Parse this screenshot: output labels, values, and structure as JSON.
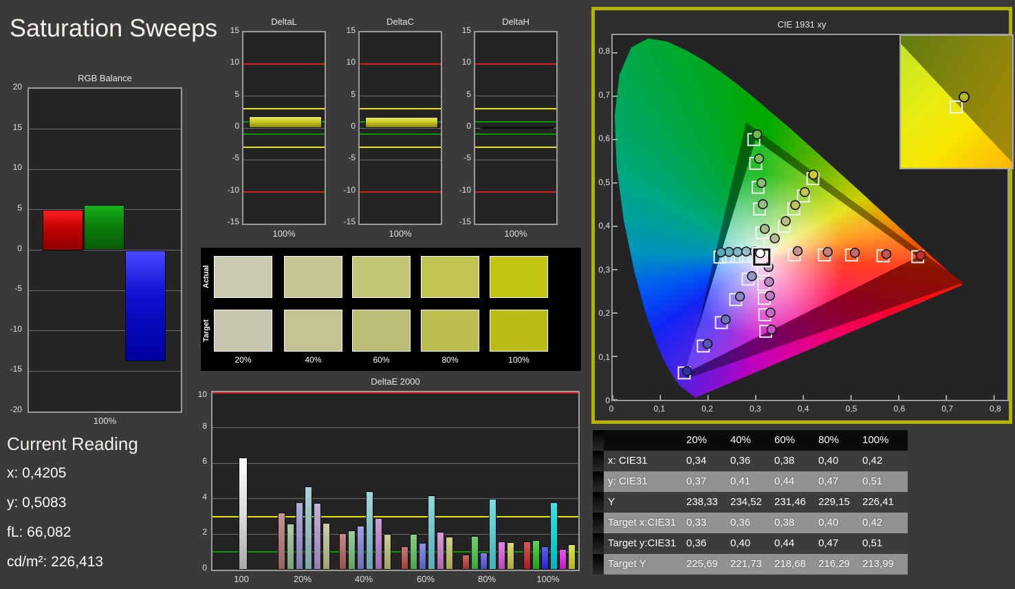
{
  "title": "Saturation Sweeps",
  "current_reading": {
    "heading": "Current Reading",
    "lines": [
      "x: 0,4205",
      "y: 0,5083",
      "fL: 66,082",
      "cd/m²: 226,413"
    ]
  },
  "chart_data": [
    {
      "id": "rgb_balance",
      "type": "bar",
      "title": "RGB Balance",
      "xlabel": "100%",
      "ylim": [
        -20,
        20
      ],
      "yticks": [
        -20,
        -15,
        -10,
        -5,
        0,
        5,
        10,
        15,
        20
      ],
      "series": [
        {
          "name": "red",
          "value": 5.0
        },
        {
          "name": "green",
          "value": 5.6
        },
        {
          "name": "blue",
          "value": -13.8
        }
      ]
    },
    {
      "id": "delta_charts",
      "type": "bar",
      "titles": [
        "DeltaL",
        "DeltaC",
        "DeltaH"
      ],
      "values": [
        1.8,
        1.7,
        0.05
      ],
      "xlabel": "100%",
      "ylim": [
        -15,
        15
      ],
      "yticks": [
        -15,
        -10,
        -5,
        0,
        5,
        10,
        15
      ],
      "ref_lines": [
        {
          "value": 10,
          "color": "#d42222"
        },
        {
          "value": -10,
          "color": "#d42222"
        },
        {
          "value": 3,
          "color": "#e6e600"
        },
        {
          "value": -3,
          "color": "#e6e600"
        },
        {
          "value": 1,
          "color": "#0c9a0c"
        },
        {
          "value": -1,
          "color": "#0c9a0c"
        }
      ]
    },
    {
      "id": "deltae_2000",
      "type": "bar",
      "title": "DeltaE 2000",
      "ylim": [
        0,
        10
      ],
      "yticks": [
        0,
        2,
        4,
        6,
        8,
        10
      ],
      "ref_lines": [
        {
          "value": 10,
          "color": "#d42222"
        },
        {
          "value": 3,
          "color": "#e6e600"
        },
        {
          "value": 1,
          "color": "#0c9a0c"
        }
      ],
      "groups": [
        {
          "label": "100",
          "values": [
            6.3
          ],
          "colors": [
            "white"
          ]
        },
        {
          "label": "20%",
          "values": [
            3.2,
            2.6,
            3.8,
            4.7,
            3.75,
            2.65
          ],
          "colors": [
            "#b57272",
            "#8fbd8f",
            "#9396cf",
            "#92c3cb",
            "#b295cd",
            "#bcbc8d"
          ]
        },
        {
          "label": "40%",
          "values": [
            2.05,
            2.2,
            2.5,
            4.4,
            2.9,
            2.0
          ],
          "colors": [
            "#b35f5f",
            "#76c076",
            "#7f82d6",
            "#7fc7d2",
            "#b57fd0",
            "#bcbc76"
          ]
        },
        {
          "label": "60%",
          "values": [
            1.3,
            2.0,
            1.5,
            4.2,
            2.15,
            1.85
          ],
          "colors": [
            "#b54c4c",
            "#5cc25c",
            "#6b6edd",
            "#66ccd6",
            "#cc7ccc",
            "#c3c35f"
          ]
        },
        {
          "label": "80%",
          "values": [
            0.85,
            1.9,
            0.95,
            4.0,
            1.6,
            1.55
          ],
          "colors": [
            "#bb3a3a",
            "#3fc43f",
            "#5456e4",
            "#4cd2da",
            "#dd55dd",
            "#caca47"
          ]
        },
        {
          "label": "100%",
          "values": [
            1.6,
            1.65,
            1.3,
            3.8,
            1.15,
            1.45
          ],
          "colors": [
            "#cc2222",
            "#22c022",
            "#2a2aee",
            "#00d8d8",
            "#dd22dd",
            "#d4d422"
          ]
        }
      ]
    },
    {
      "id": "cie_1931",
      "type": "scatter",
      "title": "CIE 1931 xy",
      "xticks": [
        "0",
        "0,1",
        "0,2",
        "0,3",
        "0,4",
        "0,5",
        "0,6",
        "0,7",
        "0,8"
      ],
      "yticks": [
        "0",
        "0,1",
        "0,2",
        "0,3",
        "0,4",
        "0,5",
        "0,6",
        "0,7",
        "0,8"
      ],
      "white_point": {
        "target": [
          0.3127,
          0.329
        ],
        "actual": [
          0.3095,
          0.338
        ]
      },
      "sweeps": [
        {
          "name": "red",
          "targets": [
            [
              0.381,
              0.334
            ],
            [
              0.444,
              0.334
            ],
            [
              0.501,
              0.334
            ],
            [
              0.567,
              0.332
            ],
            [
              0.64,
              0.33
            ]
          ],
          "actuals": [
            [
              0.388,
              0.343
            ],
            [
              0.451,
              0.341
            ],
            [
              0.508,
              0.339
            ],
            [
              0.574,
              0.336
            ],
            [
              0.646,
              0.333
            ]
          ],
          "actual_colors": [
            "#c49090",
            "#c47f7f",
            "#c46a6a",
            "#c45252",
            "#c63030"
          ]
        },
        {
          "name": "green",
          "targets": [
            [
              0.313,
              0.385
            ],
            [
              0.308,
              0.44
            ],
            [
              0.305,
              0.49
            ],
            [
              0.3,
              0.545
            ],
            [
              0.296,
              0.6
            ]
          ],
          "actuals": [
            [
              0.319,
              0.394
            ],
            [
              0.315,
              0.451
            ],
            [
              0.312,
              0.5
            ],
            [
              0.307,
              0.556
            ],
            [
              0.303,
              0.612
            ]
          ],
          "actual_colors": [
            "#a8bc8e",
            "#9cbc82",
            "#8cbc74",
            "#7cbc62",
            "#6cbc50"
          ]
        },
        {
          "name": "blue",
          "targets": [
            [
              0.284,
              0.278
            ],
            [
              0.258,
              0.231
            ],
            [
              0.228,
              0.178
            ],
            [
              0.19,
              0.124
            ],
            [
              0.15,
              0.062
            ]
          ],
          "actuals": [
            [
              0.292,
              0.285
            ],
            [
              0.267,
              0.238
            ],
            [
              0.237,
              0.185
            ],
            [
              0.199,
              0.129
            ],
            [
              0.156,
              0.066
            ]
          ],
          "actual_colors": [
            "#9898c6",
            "#8888c6",
            "#7070c2",
            "#5858bc",
            "#3030a8"
          ]
        },
        {
          "name": "cyan",
          "targets": [
            [
              0.296,
              0.331
            ],
            [
              0.279,
              0.331
            ],
            [
              0.261,
              0.33
            ],
            [
              0.243,
              0.33
            ],
            [
              0.225,
              0.329
            ]
          ],
          "actuals": [
            [
              0.297,
              0.342
            ],
            [
              0.28,
              0.342
            ],
            [
              0.262,
              0.341
            ],
            [
              0.244,
              0.341
            ],
            [
              0.227,
              0.34
            ]
          ],
          "actual_colors": [
            "#a2c2ca",
            "#92beca",
            "#7eb8c6",
            "#68b2c2",
            "#50acc0"
          ]
        },
        {
          "name": "magenta",
          "targets": [
            [
              0.316,
              0.3
            ],
            [
              0.317,
              0.266
            ],
            [
              0.318,
              0.234
            ],
            [
              0.319,
              0.196
            ],
            [
              0.321,
              0.158
            ]
          ],
          "actuals": [
            [
              0.327,
              0.306
            ],
            [
              0.328,
              0.272
            ],
            [
              0.33,
              0.24
            ],
            [
              0.331,
              0.201
            ],
            [
              0.333,
              0.162
            ]
          ],
          "actual_colors": [
            "#b894c6",
            "#bc88c6",
            "#c27cc6",
            "#c66cc6",
            "#ca50ca"
          ]
        },
        {
          "name": "yellow",
          "targets": [
            [
              0.33,
              0.36
            ],
            [
              0.36,
              0.4
            ],
            [
              0.38,
              0.44
            ],
            [
              0.4,
              0.47
            ],
            [
              0.42,
              0.51
            ]
          ],
          "actuals": [
            [
              0.34,
              0.372
            ],
            [
              0.363,
              0.412
            ],
            [
              0.383,
              0.449
            ],
            [
              0.403,
              0.479
            ],
            [
              0.421,
              0.519
            ]
          ],
          "actual_colors": [
            "#bcbc94",
            "#bcbc7e",
            "#c0c066",
            "#c4c44e",
            "#c8c832"
          ]
        }
      ]
    }
  ],
  "swatches": {
    "row_labels": [
      "Actual",
      "Target"
    ],
    "col_labels": [
      "20%",
      "40%",
      "60%",
      "80%",
      "100%"
    ],
    "actual_colors": [
      "#c9c9b0",
      "#c6c694",
      "#c3c577",
      "#c3c553",
      "#c3c513"
    ],
    "target_colors": [
      "#c6c6ae",
      "#c2c292",
      "#bcbd75",
      "#babc50",
      "#b9bc15"
    ]
  },
  "table": {
    "col_headers": [
      "20%",
      "40%",
      "60%",
      "80%",
      "100%"
    ],
    "rows": [
      {
        "label": "x: CIE31",
        "values": [
          "0,34",
          "0,36",
          "0,38",
          "0,40",
          "0,42"
        ]
      },
      {
        "label": "y: CIE31",
        "values": [
          "0,37",
          "0,41",
          "0,44",
          "0,47",
          "0,51"
        ]
      },
      {
        "label": "Y",
        "values": [
          "238,33",
          "234,52",
          "231,46",
          "229,15",
          "226,41"
        ]
      },
      {
        "label": "Target x:CIE31",
        "values": [
          "0,33",
          "0,36",
          "0,38",
          "0,40",
          "0,42"
        ]
      },
      {
        "label": "Target y:CIE31",
        "values": [
          "0,36",
          "0,40",
          "0,44",
          "0,47",
          "0,51"
        ]
      },
      {
        "label": "Target Y",
        "values": [
          "225,69",
          "221,73",
          "218,68",
          "216,29",
          "213,99"
        ]
      }
    ]
  }
}
